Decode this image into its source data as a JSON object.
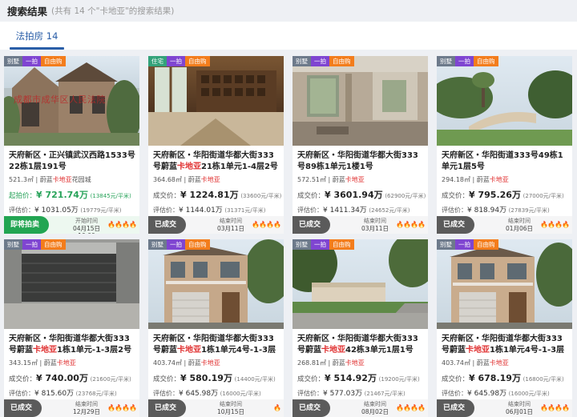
{
  "header": {
    "title": "搜索结果",
    "count_text": "(共有 14 个\"卡地亚\"的搜索结果)"
  },
  "tabs": [
    {
      "label": "法拍房 14",
      "active": true
    }
  ],
  "cards": [
    {
      "tags": [
        {
          "text": "别墅",
          "kind": "villa"
        },
        {
          "text": "一拍",
          "kind": "first"
        },
        {
          "text": "自由购",
          "kind": "free"
        }
      ],
      "watermark": "成都市成华区人民法院",
      "address_pre": "天府新区・正兴镇武汉西路1533号22栋1层191号",
      "address_hl": "",
      "address_post": "",
      "area": "521.3㎡",
      "community_pre": "蔚蓝",
      "community_hl": "卡地亚",
      "community_post": "花园城",
      "price_label": "起拍价：",
      "price": "¥ 721.74万",
      "unit_price": "(13845元/平米)",
      "eval_label": "评估价：",
      "eval_price": "¥ 1031.05万",
      "eval_unit": "(19779元/平米)",
      "status": "即将拍卖",
      "time_label": "开始时间",
      "time_value": "04月15日 10:00",
      "heat": "🔥🔥🔥🔥",
      "live": true
    },
    {
      "tags": [
        {
          "text": "住宅",
          "kind": "home"
        },
        {
          "text": "一拍",
          "kind": "first"
        },
        {
          "text": "自由购",
          "kind": "free"
        }
      ],
      "watermark": "",
      "address_pre": "天府新区・华阳街道华都大街333号蔚蓝",
      "address_hl": "卡地亚",
      "address_post": "21栋1单元1-4层2号",
      "area": "364.68㎡",
      "community_pre": "蔚蓝",
      "community_hl": "卡地亚",
      "community_post": "",
      "price_label": "成交价：",
      "price": "¥ 1224.81万",
      "unit_price": "(33600元/平米)",
      "eval_label": "评估价：",
      "eval_price": "¥ 1144.01万",
      "eval_unit": "(31371元/平米)",
      "status": "已成交",
      "time_label": "结束时间",
      "time_value": "03月11日",
      "heat": "🔥🔥🔥🔥",
      "live": false
    },
    {
      "tags": [
        {
          "text": "别墅",
          "kind": "villa"
        },
        {
          "text": "一拍",
          "kind": "first"
        },
        {
          "text": "自由购",
          "kind": "free"
        }
      ],
      "watermark": "",
      "address_pre": "天府新区・华阳街道华都大街333号89栋1单元1楼1号",
      "address_hl": "",
      "address_post": "",
      "area": "572.51㎡",
      "community_pre": "蔚蓝",
      "community_hl": "卡地亚",
      "community_post": "",
      "price_label": "成交价：",
      "price": "¥ 3601.94万",
      "unit_price": "(62900元/平米)",
      "eval_label": "评估价：",
      "eval_price": "¥ 1411.34万",
      "eval_unit": "(24652元/平米)",
      "status": "已成交",
      "time_label": "结束时间",
      "time_value": "03月11日",
      "heat": "🔥🔥🔥🔥",
      "live": false
    },
    {
      "tags": [
        {
          "text": "别墅",
          "kind": "villa"
        },
        {
          "text": "一拍",
          "kind": "first"
        },
        {
          "text": "自由购",
          "kind": "free"
        }
      ],
      "watermark": "",
      "address_pre": "天府新区・华阳街道333号49栋1单元1层5号",
      "address_hl": "",
      "address_post": "",
      "area": "294.18㎡",
      "community_pre": "蔚蓝",
      "community_hl": "卡地亚",
      "community_post": "",
      "price_label": "成交价：",
      "price": "¥ 795.26万",
      "unit_price": "(27000元/平米)",
      "eval_label": "评估价：",
      "eval_price": "¥ 818.94万",
      "eval_unit": "(27839元/平米)",
      "status": "已成交",
      "time_label": "结束时间",
      "time_value": "01月06日",
      "heat": "🔥🔥🔥🔥",
      "live": false
    },
    {
      "tags": [
        {
          "text": "别墅",
          "kind": "villa"
        },
        {
          "text": "一拍",
          "kind": "first"
        },
        {
          "text": "自由购",
          "kind": "free"
        }
      ],
      "watermark": "",
      "address_pre": "天府新区・华阳街道华都大街333号蔚蓝",
      "address_hl": "卡地亚",
      "address_post": "1栋1单元-1-3层2号",
      "area": "343.15㎡",
      "community_pre": "蔚蓝",
      "community_hl": "卡地亚",
      "community_post": "",
      "price_label": "成交价：",
      "price": "¥ 740.00万",
      "unit_price": "(21600元/平米)",
      "eval_label": "评估价：",
      "eval_price": "¥ 815.60万",
      "eval_unit": "(23768元/平米)",
      "status": "已成交",
      "time_label": "结束时间",
      "time_value": "12月29日",
      "heat": "🔥🔥🔥🔥",
      "live": false
    },
    {
      "tags": [
        {
          "text": "别墅",
          "kind": "villa"
        },
        {
          "text": "一拍",
          "kind": "first"
        },
        {
          "text": "自由购",
          "kind": "free"
        }
      ],
      "watermark": "",
      "address_pre": "天府新区・华阳街道华都大街333号蔚蓝",
      "address_hl": "卡地亚",
      "address_post": "1栋1单元4号-1-3层房屋",
      "area": "403.74㎡",
      "community_pre": "蔚蓝",
      "community_hl": "卡地亚",
      "community_post": "",
      "price_label": "成交价：",
      "price": "¥ 580.19万",
      "unit_price": "(14400元/平米)",
      "eval_label": "评估价：",
      "eval_price": "¥ 645.98万",
      "eval_unit": "(16000元/平米)",
      "status": "已成交",
      "time_label": "结束时间",
      "time_value": "10月15日",
      "heat": "🔥",
      "live": false
    },
    {
      "tags": [
        {
          "text": "别墅",
          "kind": "villa"
        },
        {
          "text": "一拍",
          "kind": "first"
        },
        {
          "text": "自由购",
          "kind": "free"
        }
      ],
      "watermark": "",
      "address_pre": "天府新区・华阳街道华都大街333号蔚蓝",
      "address_hl": "卡地亚",
      "address_post": "42栋3单元1层1号",
      "area": "268.81㎡",
      "community_pre": "蔚蓝",
      "community_hl": "卡地亚",
      "community_post": "",
      "price_label": "成交价：",
      "price": "¥ 514.92万",
      "unit_price": "(19200元/平米)",
      "eval_label": "评估价：",
      "eval_price": "¥ 577.03万",
      "eval_unit": "(21467元/平米)",
      "status": "已成交",
      "time_label": "结束时间",
      "time_value": "08月02日",
      "heat": "🔥🔥🔥🔥",
      "live": false
    },
    {
      "tags": [
        {
          "text": "别墅",
          "kind": "villa"
        },
        {
          "text": "一拍",
          "kind": "first"
        },
        {
          "text": "自由购",
          "kind": "free"
        }
      ],
      "watermark": "",
      "address_pre": "天府新区・华阳街道华都大街333号蔚蓝",
      "address_hl": "卡地亚",
      "address_post": "1栋1单元4号-1-3层房屋",
      "area": "403.74㎡",
      "community_pre": "蔚蓝",
      "community_hl": "卡地亚",
      "community_post": "",
      "price_label": "成交价：",
      "price": "¥ 678.19万",
      "unit_price": "(16800元/平米)",
      "eval_label": "评估价：",
      "eval_price": "¥ 645.98万",
      "eval_unit": "(16000元/平米)",
      "status": "已成交",
      "time_label": "结束时间",
      "time_value": "06月01日",
      "heat": "🔥🔥🔥🔥",
      "live": false
    }
  ]
}
